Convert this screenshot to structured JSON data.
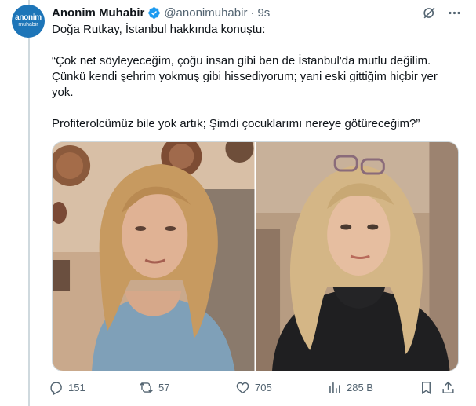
{
  "tweet": {
    "author_name": "Anonim Muhabir",
    "handle": "@anonimuhabir",
    "separator": "·",
    "time": "9s",
    "avatar": {
      "line1": "anonim",
      "line2": "muhabir"
    },
    "paragraphs": [
      "Doğa Rutkay, İstanbul hakkında konuştu:",
      "“Çok net söyleyeceğim, çoğu insan gibi ben de İstanbul'da mutlu değilim. Çünkü kendi şehrim yokmuş gibi hissediyorum; yani eski gittiğim hiçbir yer yok.",
      "Profiterolcümüz bile yok artık; Şimdi çocuklarımı nereye götüreceğim?”"
    ],
    "media": [
      {
        "icon": "woman-photo-left"
      },
      {
        "icon": "woman-photo-right"
      }
    ]
  },
  "actions": {
    "replies": "151",
    "reposts": "57",
    "likes": "705",
    "views": "285 B"
  },
  "icons": {
    "verified": "verified-badge-icon",
    "grok": "grok-icon",
    "more": "more-icon",
    "reply": "reply-icon",
    "repost": "repost-icon",
    "like": "heart-icon",
    "views": "views-icon",
    "bookmark": "bookmark-icon",
    "share": "share-icon"
  },
  "colors": {
    "verified": "#1d9bf0",
    "muted": "#536471",
    "text": "#0f1419",
    "avatar_bg": "#1d75b8"
  }
}
